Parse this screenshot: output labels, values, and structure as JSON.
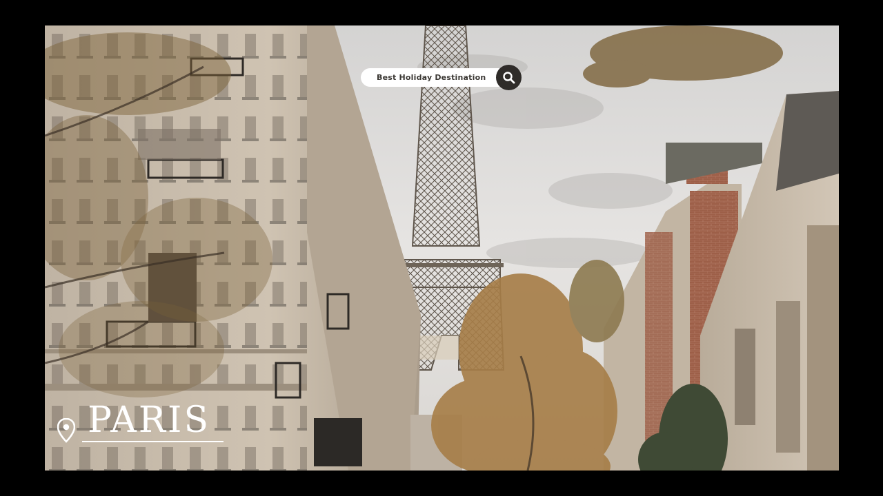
{
  "search": {
    "text": "Best Holiday Destination",
    "icon": "search-icon"
  },
  "location": {
    "title": "PARIS",
    "icon": "location-pin-icon"
  },
  "colors": {
    "sky": "#dcdad6",
    "stone": "#c8bba9",
    "brick": "#9a5b45",
    "tower": "#6e6458",
    "foliage": "#a37b47",
    "dark_button": "#2f2c29"
  }
}
